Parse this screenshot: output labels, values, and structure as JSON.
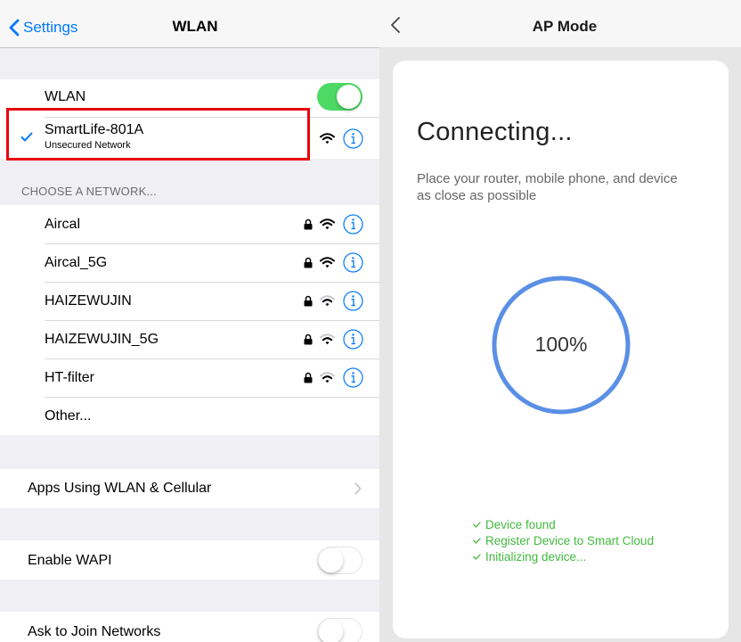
{
  "settings": {
    "nav": {
      "back_label": "Settings",
      "title": "WLAN"
    },
    "wlan": {
      "label": "WLAN",
      "enabled": true
    },
    "connected": {
      "name": "SmartLife-801A",
      "status": "Unsecured Network"
    },
    "choose_header": "CHOOSE A NETWORK...",
    "networks": [
      {
        "name": "Aircal",
        "locked": true
      },
      {
        "name": "Aircal_5G",
        "locked": true
      },
      {
        "name": "HAIZEWUJIN",
        "locked": true
      },
      {
        "name": "HAIZEWUJIN_5G",
        "locked": true
      },
      {
        "name": "HT-filter",
        "locked": true
      }
    ],
    "other_label": "Other...",
    "apps_label": "Apps Using WLAN & Cellular",
    "enable_wapi": {
      "label": "Enable WAPI",
      "enabled": false
    },
    "ask_join": {
      "label": "Ask to Join Networks",
      "enabled": false
    }
  },
  "ap_mode": {
    "nav_title": "AP Mode",
    "heading": "Connecting...",
    "instruction": "Place your router, mobile phone, and device as close as possible",
    "progress_label": "100%",
    "progress_value": 1.0,
    "steps": [
      "Device found",
      "Register Device to Smart Cloud",
      "Initializing device..."
    ]
  },
  "colors": {
    "ios_blue": "#007aff",
    "toggle_green": "#4cd964",
    "highlight_red": "#e8000c",
    "progress_blue": "#5a8fe6",
    "step_green": "#42b93f"
  }
}
